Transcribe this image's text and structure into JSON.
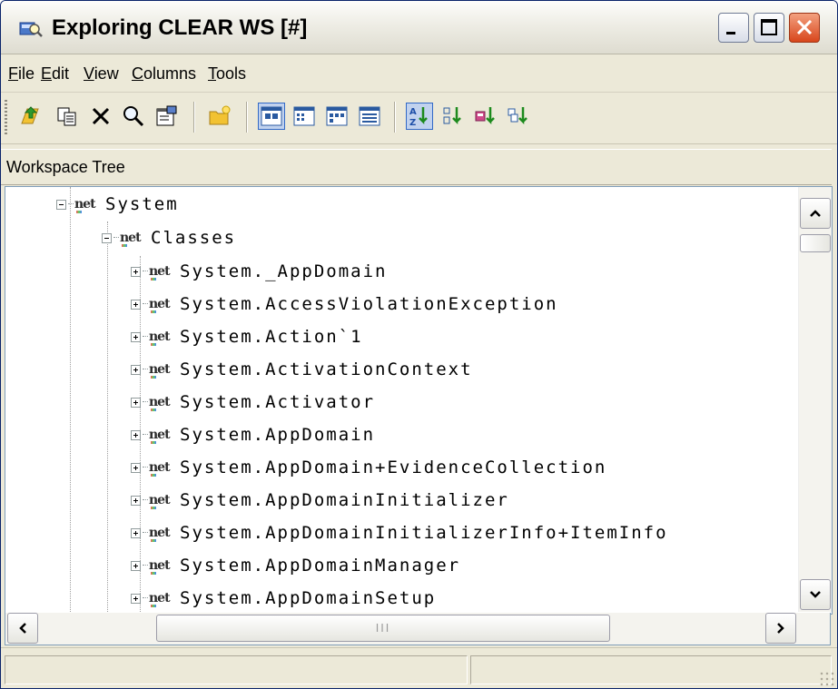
{
  "window": {
    "title": "Exploring CLEAR WS [#]",
    "icon": "explorer-magnifier-icon"
  },
  "menubar": {
    "items": [
      "File",
      "Edit",
      "View",
      "Columns",
      "Tools"
    ]
  },
  "toolbar": {
    "icons": [
      "up-folder-icon",
      "copy-icon",
      "delete-icon",
      "find-icon",
      "properties-icon",
      "new-folder-icon",
      "large-icons-view-icon",
      "small-icons-view-icon",
      "list-view-icon",
      "details-view-icon",
      "sort-by-name-icon",
      "sort-by-type-icon",
      "sort-by-size-icon",
      "sort-by-date-icon"
    ]
  },
  "section_header": {
    "label": "Workspace Tree"
  },
  "tree": {
    "icon_text": "net",
    "root": {
      "label": "System"
    },
    "group": {
      "label": "Classes"
    },
    "items": [
      "System._AppDomain",
      "System.AccessViolationException",
      "System.Action`1",
      "System.ActivationContext",
      "System.Activator",
      "System.AppDomain",
      "System.AppDomain+EvidenceCollection",
      "System.AppDomainInitializer",
      "System.AppDomainInitializerInfo+ItemInfo",
      "System.AppDomainManager",
      "System.AppDomainSetup"
    ]
  },
  "scrollbars": {
    "horizontal_thumb_grip": "III"
  }
}
